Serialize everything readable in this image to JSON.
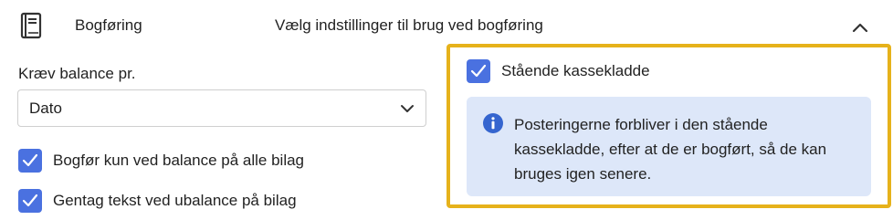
{
  "header": {
    "icon": "book-icon",
    "title": "Bogføring",
    "description": "Vælg indstillinger til brug ved bogføring",
    "collapse_icon": "chevron-up-icon"
  },
  "balance": {
    "label": "Kræv balance pr.",
    "selected": "Dato",
    "dropdown_icon": "chevron-down-icon"
  },
  "options": [
    {
      "label": "Bogfør kun ved balance på alle bilag",
      "checked": true
    },
    {
      "label": "Gentag tekst ved ubalance på bilag",
      "checked": true
    }
  ],
  "standing_journal": {
    "label": "Stående kassekladde",
    "checked": true,
    "info_icon": "info-icon",
    "info_text": "Posteringerne forbliver i den stående kassekladde, efter at de er bogført, så de kan bruges igen senere."
  },
  "colors": {
    "accent": "#4a71e0",
    "highlight_border": "#e6b21b",
    "info_background": "#dde7f9"
  }
}
